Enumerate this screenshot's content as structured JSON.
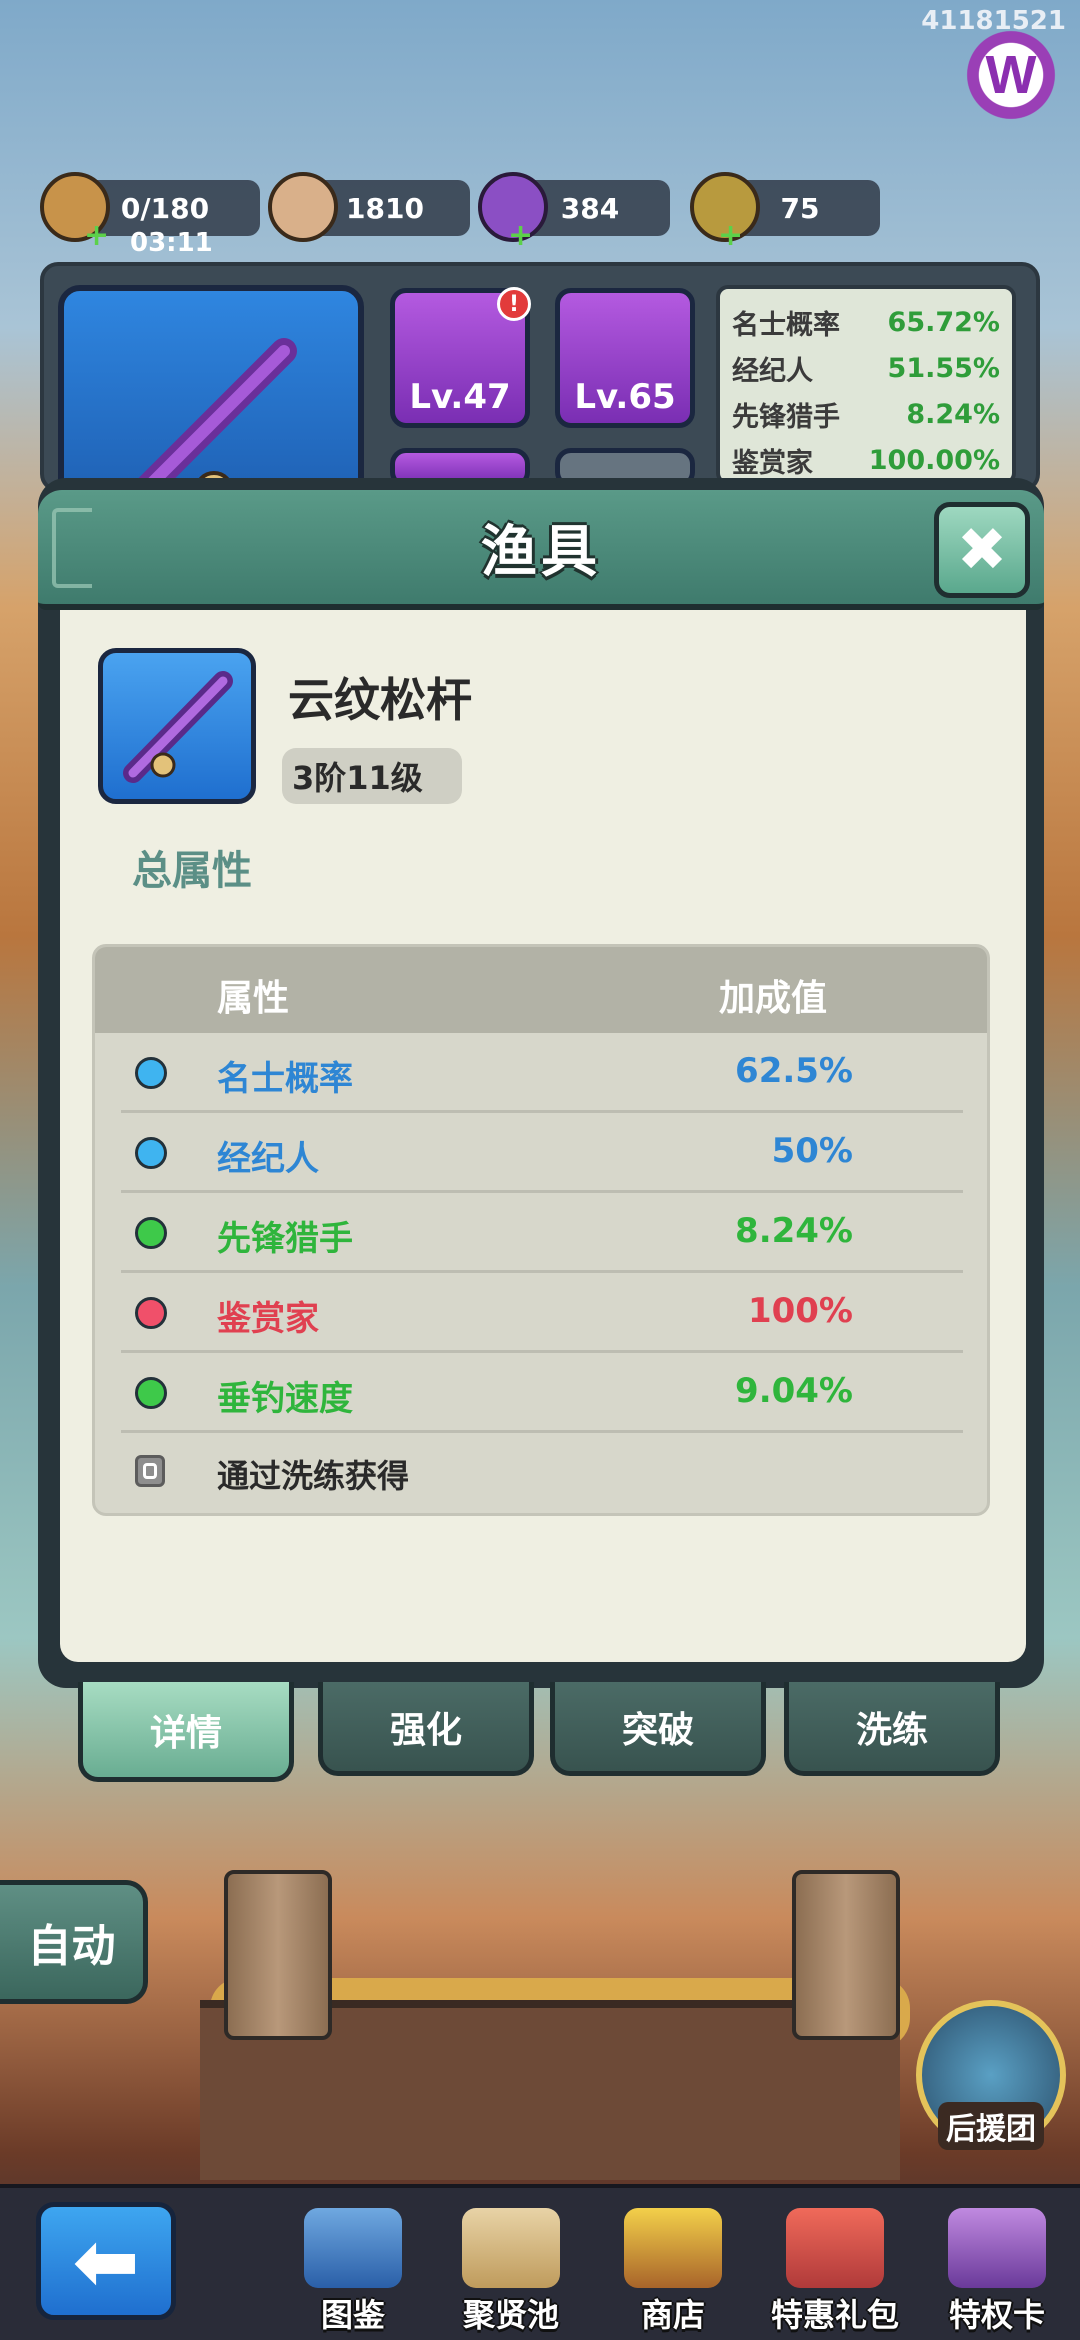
{
  "top_id": "41181521",
  "currencies": [
    {
      "name": "stamina",
      "value": "0/180",
      "sub": "03:11"
    },
    {
      "name": "coin",
      "value": "1810"
    },
    {
      "name": "gem",
      "value": "384"
    },
    {
      "name": "ticket",
      "value": "75"
    }
  ],
  "equipment_slots": [
    {
      "level": "Lv.47",
      "alert": "!"
    },
    {
      "level": "Lv.65"
    }
  ],
  "bg_stats": [
    {
      "label": "名士概率",
      "value": "65.72%"
    },
    {
      "label": "经纪人",
      "value": "51.55%"
    },
    {
      "label": "先锋猎手",
      "value": "8.24%"
    },
    {
      "label": "鉴赏家",
      "value": "100.00%"
    }
  ],
  "dialog": {
    "title": "渔具",
    "close_label": "✖",
    "item_name": "云纹松杆",
    "item_level": "3阶11级",
    "section_title": "总属性",
    "table_header": {
      "attr": "属性",
      "value": "加成值"
    },
    "rows": [
      {
        "label": "名士概率",
        "value": "62.5%",
        "color": "#2e86d4",
        "dot": "#3fb4f0"
      },
      {
        "label": "经纪人",
        "value": "50%",
        "color": "#2e86d4",
        "dot": "#3fb4f0"
      },
      {
        "label": "先锋猎手",
        "value": "8.24%",
        "color": "#2fb53c",
        "dot": "#3ec94a"
      },
      {
        "label": "鉴赏家",
        "value": "100%",
        "color": "#e04050",
        "dot": "#f0506a"
      },
      {
        "label": "垂钓速度",
        "value": "9.04%",
        "color": "#2fb53c",
        "dot": "#3ec94a"
      }
    ],
    "locked_text": "通过洗练获得"
  },
  "tabs": [
    {
      "label": "详情",
      "active": true
    },
    {
      "label": "强化"
    },
    {
      "label": "突破"
    },
    {
      "label": "洗练"
    }
  ],
  "auto_label": "自动",
  "support_label": "后援团",
  "bottom_nav": [
    {
      "label": "图鉴"
    },
    {
      "label": "聚贤池"
    },
    {
      "label": "商店"
    },
    {
      "label": "特惠礼包"
    },
    {
      "label": "特权卡"
    }
  ],
  "logo_letter": "W"
}
